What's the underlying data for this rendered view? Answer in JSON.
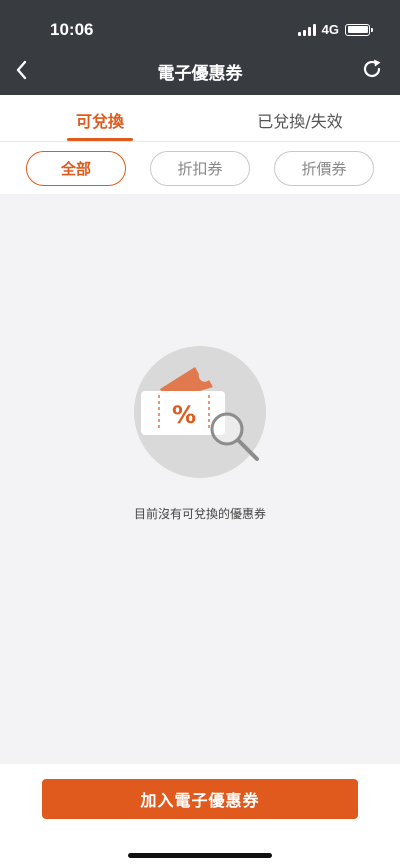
{
  "status_bar": {
    "time": "10:06",
    "network": "4G"
  },
  "nav": {
    "title": "電子優惠券"
  },
  "tabs": [
    {
      "label": "可兌換",
      "active": true
    },
    {
      "label": "已兌換/失效",
      "active": false
    }
  ],
  "filters": [
    {
      "label": "全部",
      "active": true
    },
    {
      "label": "折扣券",
      "active": false
    },
    {
      "label": "折價券",
      "active": false
    }
  ],
  "empty_state": {
    "message": "目前沒有可兌換的優惠券",
    "icon": "coupon-search-icon"
  },
  "footer": {
    "add_label": "加入電子優惠券"
  },
  "colors": {
    "accent": "#e15a1d",
    "header_bg": "#383b40",
    "page_bg": "#f3f3f5"
  }
}
